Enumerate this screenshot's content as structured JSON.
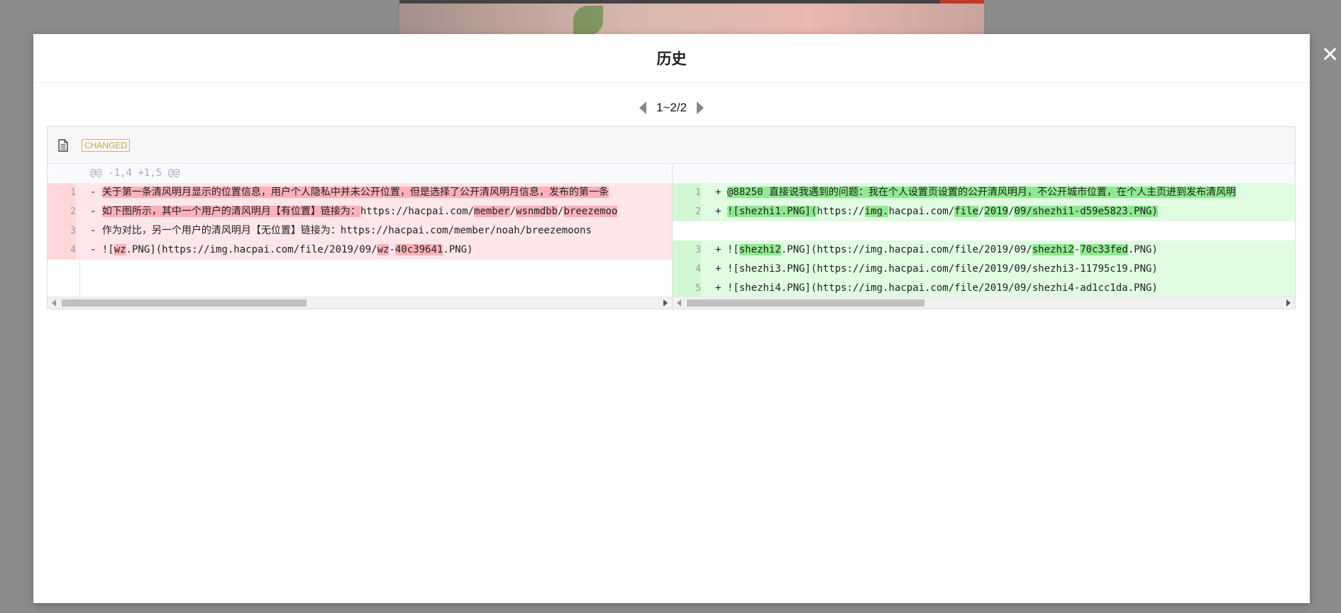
{
  "modal": {
    "title": "历史",
    "close_glyph": "✕"
  },
  "pager": {
    "text": "1~2/2",
    "prev_icon": "caret-left-icon",
    "next_icon": "caret-right-icon"
  },
  "diff": {
    "file_icon": "file-text-icon",
    "status": "CHANGED",
    "hunk_header": "@@ -1,4 +1,5 @@",
    "colors": {
      "deleted_bg": "#ffe6e8",
      "deleted_highlight": "#fcb1b8",
      "added_bg": "#e0fde1",
      "added_highlight": "#8fea8f",
      "badge": "#c9a92a"
    },
    "left": {
      "lines": [
        {
          "num": "1",
          "segments": [
            {
              "t": "- "
            },
            {
              "t": "关于第一条清风明月显示的位置信息，用户个人隐私中并未公开位置，但是选择了公开清风明月信息，发布的第一条",
              "hl": true
            }
          ]
        },
        {
          "num": "2",
          "segments": [
            {
              "t": "- "
            },
            {
              "t": "如下图所示，其中一个用户的清风明月【有位置】链接为：",
              "hl": true
            },
            {
              "t": "https://hacpai.com/"
            },
            {
              "t": "member",
              "hl": true
            },
            {
              "t": "/"
            },
            {
              "t": "wsnmdbb",
              "hl": true
            },
            {
              "t": "/"
            },
            {
              "t": "breezemoo",
              "hl": true
            }
          ]
        },
        {
          "num": "3",
          "segments": [
            {
              "t": "- 作为对比，另一个用户的清风明月【无位置】链接为：https://hacpai.com/member/noah/breezemoons"
            }
          ]
        },
        {
          "num": "4",
          "segments": [
            {
              "t": "- !["
            },
            {
              "t": "wz",
              "hl": true
            },
            {
              "t": ".PNG](https://img.hacpai.com/file/2019/09/"
            },
            {
              "t": "wz",
              "hl": true
            },
            {
              "t": "-"
            },
            {
              "t": "40c39641",
              "hl": true
            },
            {
              "t": ".PNG)"
            }
          ]
        }
      ]
    },
    "right": {
      "lines": [
        {
          "num": "1",
          "segments": [
            {
              "t": "+ "
            },
            {
              "t": "@88250 直接说我遇到的问题：我在个人设置页设置的公开清风明月，不公开城市位置，在个人主页进到发布清风明",
              "hl": true
            }
          ]
        },
        {
          "num": "2",
          "segments": [
            {
              "t": "+ "
            },
            {
              "t": "![shezhi1.PNG](",
              "hl": true
            },
            {
              "t": "https://"
            },
            {
              "t": "img.",
              "hl": true
            },
            {
              "t": "hacpai.com/"
            },
            {
              "t": "file",
              "hl": true
            },
            {
              "t": "/"
            },
            {
              "t": "2019",
              "hl": true
            },
            {
              "t": "/"
            },
            {
              "t": "09/shezhi1-d59e5823.PNG)",
              "hl": true
            }
          ]
        },
        {
          "num": "3",
          "segments": [
            {
              "t": "+ !["
            },
            {
              "t": "shezhi2",
              "hl": true
            },
            {
              "t": ".PNG](https://img.hacpai.com/file/2019/09/"
            },
            {
              "t": "shezhi2",
              "hl": true
            },
            {
              "t": "-"
            },
            {
              "t": "70c33fed",
              "hl": true
            },
            {
              "t": ".PNG)"
            }
          ]
        },
        {
          "num": "4",
          "segments": [
            {
              "t": "+ ![shezhi3.PNG](https://img.hacpai.com/file/2019/09/shezhi3-11795c19.PNG)"
            }
          ]
        },
        {
          "num": "5",
          "segments": [
            {
              "t": "+ ![shezhi4.PNG](https://img.hacpai.com/file/2019/09/shezhi4-ad1cc1da.PNG)"
            }
          ]
        }
      ]
    }
  }
}
